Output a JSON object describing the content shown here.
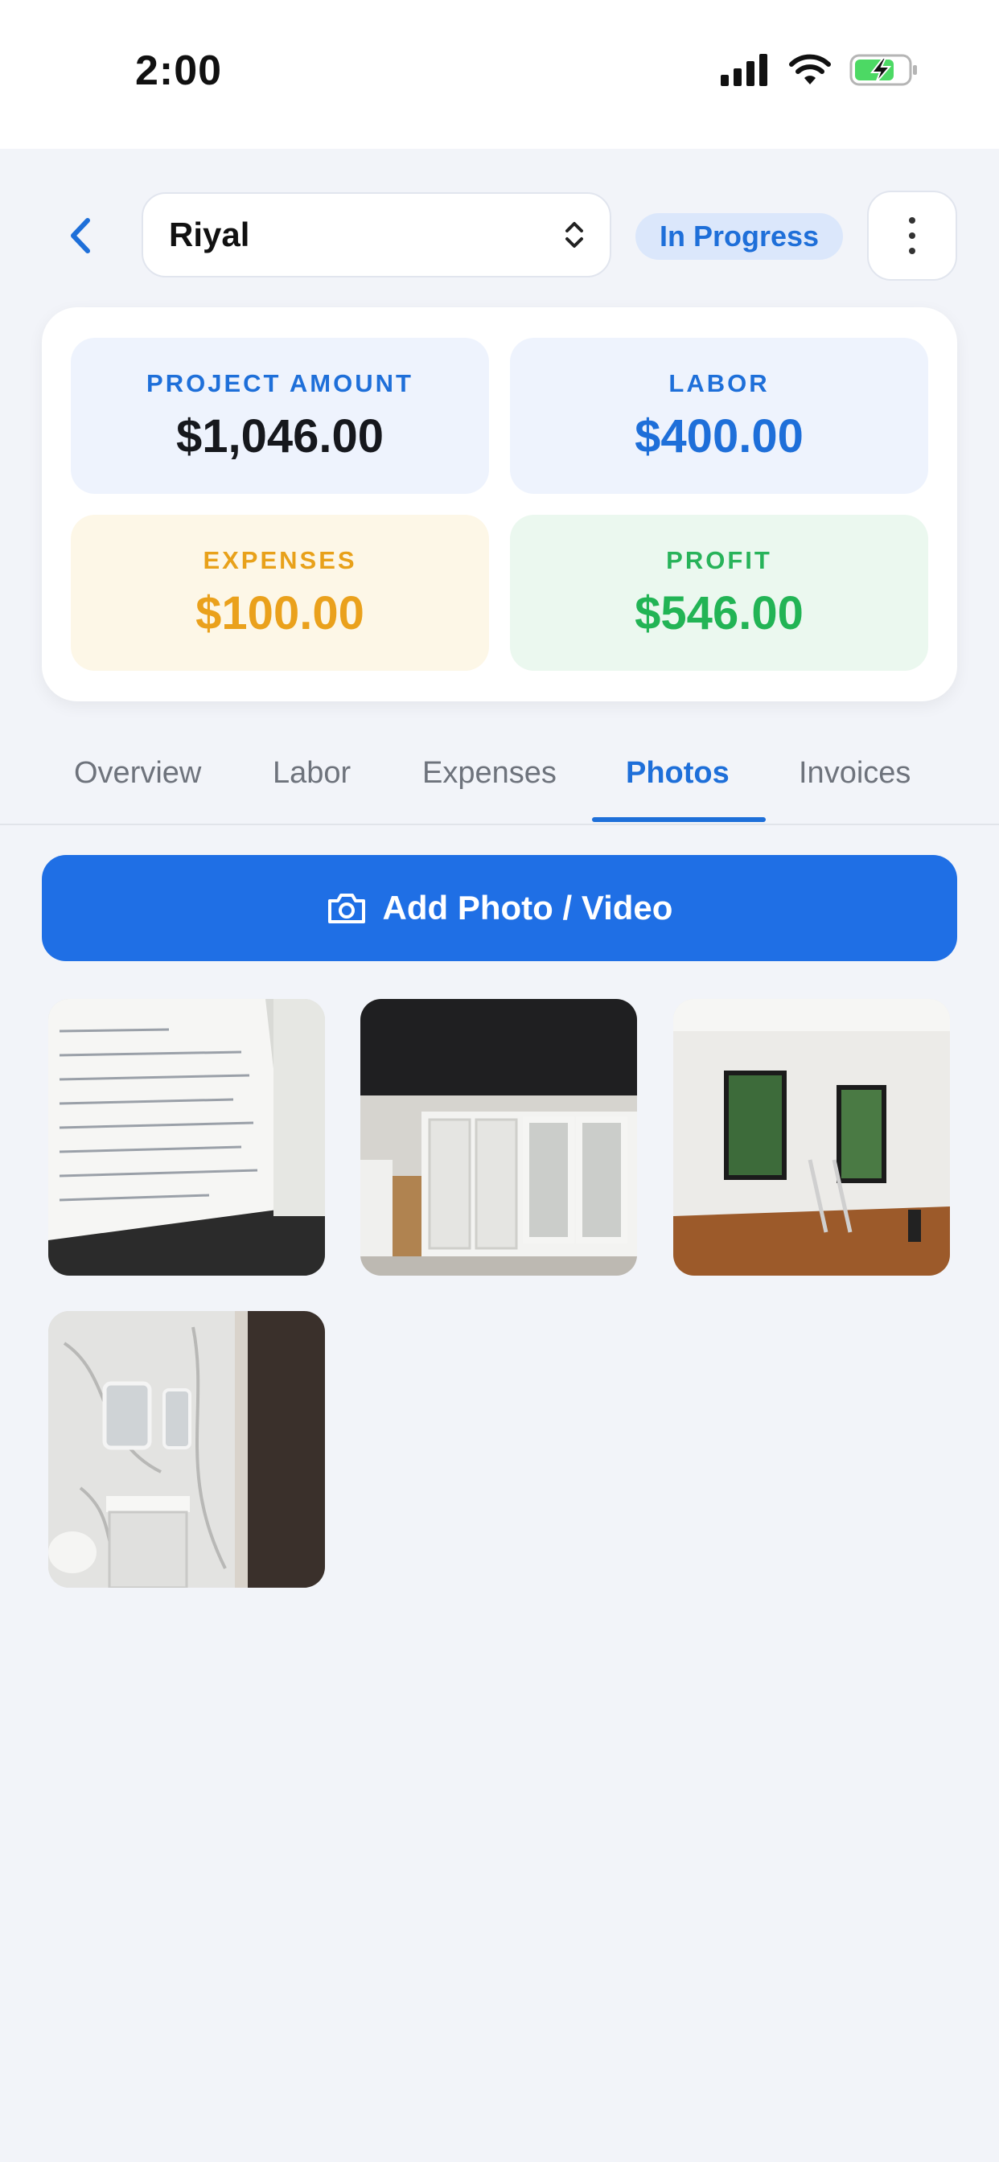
{
  "status_bar": {
    "time": "2:00"
  },
  "header": {
    "project_name": "Riyal",
    "status": "In Progress"
  },
  "summary": {
    "project_amount": {
      "label": "PROJECT AMOUNT",
      "value": "$1,046.00"
    },
    "labor": {
      "label": "LABOR",
      "value": "$400.00"
    },
    "expenses": {
      "label": "EXPENSES",
      "value": "$100.00"
    },
    "profit": {
      "label": "PROFIT",
      "value": "$546.00"
    }
  },
  "tabs": [
    {
      "label": "Overview"
    },
    {
      "label": "Labor"
    },
    {
      "label": "Expenses"
    },
    {
      "label": "Photos"
    },
    {
      "label": "Invoices"
    }
  ],
  "active_tab": "Photos",
  "add_button": {
    "label": "Add Photo / Video"
  },
  "colors": {
    "accent": "#1e6fd9",
    "expenses": "#eaa11c",
    "profit": "#22b455"
  }
}
